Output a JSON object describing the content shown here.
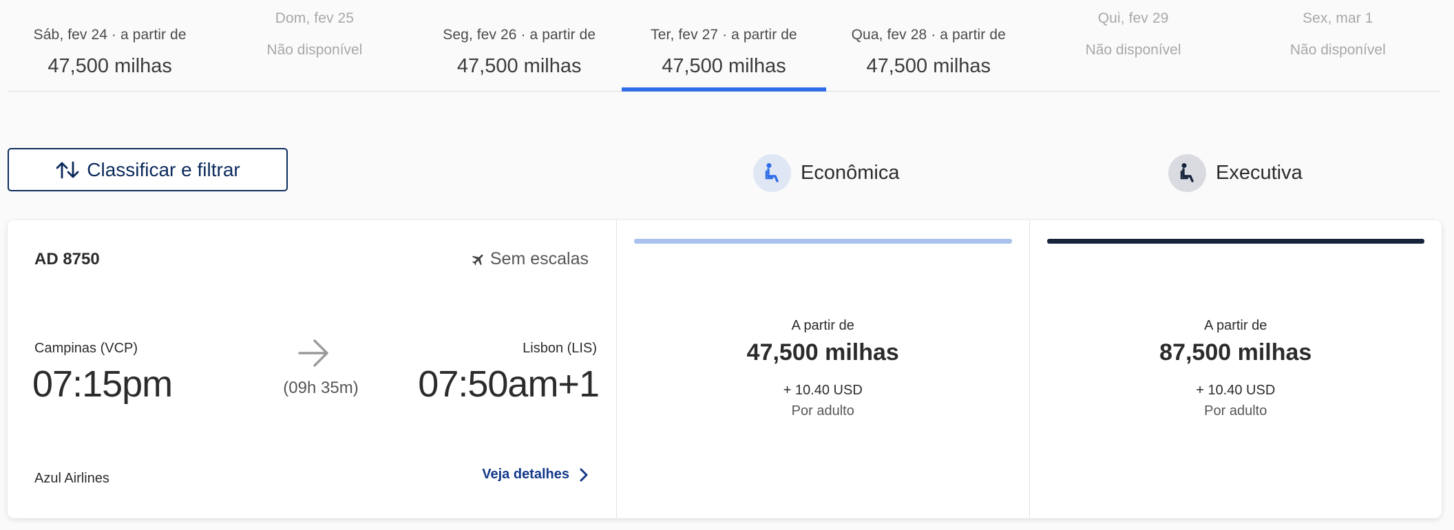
{
  "date_tabs": [
    {
      "label": "Sáb, fev 24 · a partir de",
      "value": "47,500 milhas",
      "available": true,
      "selected": false
    },
    {
      "label": "Dom, fev 25",
      "value": "Não disponível",
      "available": false,
      "selected": false
    },
    {
      "label": "Seg, fev 26 · a partir de",
      "value": "47,500 milhas",
      "available": true,
      "selected": false
    },
    {
      "label": "Ter, fev 27 · a partir de",
      "value": "47,500 milhas",
      "available": true,
      "selected": true
    },
    {
      "label": "Qua, fev 28 · a partir de",
      "value": "47,500 milhas",
      "available": true,
      "selected": false
    },
    {
      "label": "Qui, fev 29",
      "value": "Não disponível",
      "available": false,
      "selected": false
    },
    {
      "label": "Sex, mar 1",
      "value": "Não disponível",
      "available": false,
      "selected": false
    }
  ],
  "filter": {
    "label": "Classificar e filtrar",
    "icon": "sort-arrows-icon"
  },
  "cabins": {
    "economy": {
      "label": "Econômica",
      "icon": "seat-icon"
    },
    "executive": {
      "label": "Executiva",
      "icon": "seat-icon"
    }
  },
  "flight": {
    "number": "AD 8750",
    "stops": "Sem escalas",
    "origin_city": "Campinas (VCP)",
    "departure_time": "07:15pm",
    "destination_city": "Lisbon (LIS)",
    "arrival_time": "07:50am+1",
    "duration": "(09h 35m)",
    "airline": "Azul Airlines",
    "details_label": "Veja detalhes"
  },
  "fares": {
    "economy": {
      "from_label": "A partir de",
      "price": "47,500 milhas",
      "tax": "+ 10.40 USD",
      "per": "Por adulto"
    },
    "executive": {
      "from_label": "A partir de",
      "price": "87,500 milhas",
      "tax": "+ 10.40 USD",
      "per": "Por adulto"
    }
  },
  "colors": {
    "accent": "#2f6ee8",
    "navy": "#0b2a5b",
    "economy_bar": "#a9c1ec",
    "executive_bar": "#16233a",
    "link": "#12388a"
  }
}
